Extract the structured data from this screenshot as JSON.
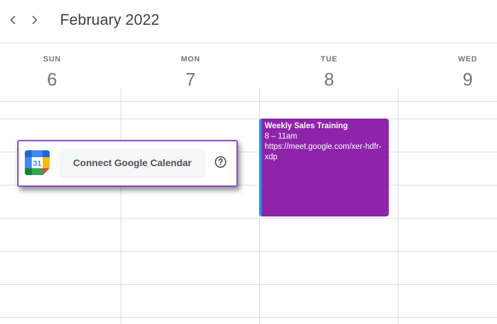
{
  "header": {
    "month_title": "February 2022",
    "prev_icon": "chevron-left-icon",
    "next_icon": "chevron-right-icon"
  },
  "days": [
    {
      "dow": "SUN",
      "num": "6"
    },
    {
      "dow": "MON",
      "num": "7"
    },
    {
      "dow": "TUE",
      "num": "8"
    },
    {
      "dow": "WED",
      "num": "9"
    }
  ],
  "event": {
    "title": "Weekly Sales Training",
    "time": "8 – 11am",
    "url": "https://meet.google.com/xer-hdfr-xdp",
    "color": "#8e24aa",
    "accent": "#039be5"
  },
  "connect_popup": {
    "logo_text": "31",
    "button_label": "Connect Google Calendar",
    "help_icon": "question-circle-icon",
    "border_color": "#8e44c8"
  }
}
